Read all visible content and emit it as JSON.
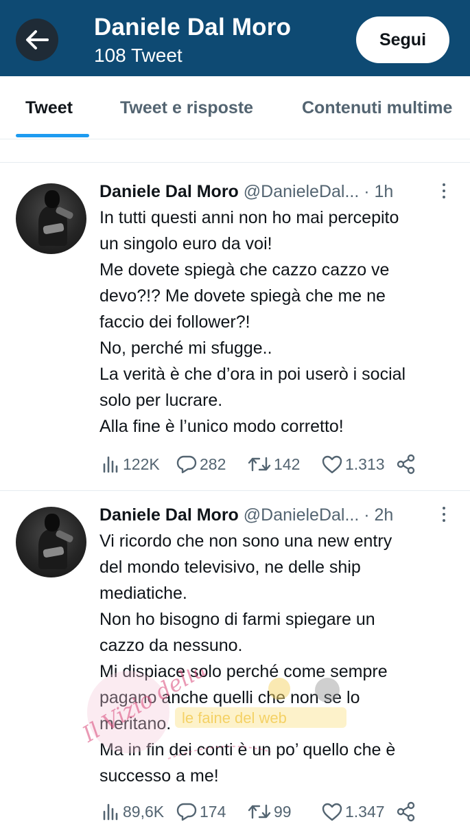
{
  "header": {
    "title": "Daniele Dal Moro",
    "subtitle": "108 Tweet",
    "follow_label": "Segui",
    "background": "#0e4a73"
  },
  "tabs": [
    {
      "label": "Tweet",
      "active": true
    },
    {
      "label": "Tweet e risposte",
      "active": false
    },
    {
      "label": "Contenuti multime",
      "active": false
    }
  ],
  "accent": "#1d9bf0",
  "tweets": [
    {
      "name": "Daniele Dal Moro",
      "handle": "@DanieleDal...",
      "time": "· 1h",
      "lines": [
        "In tutti questi anni non ho mai percepito",
        "un singolo euro da voi!",
        "Me dovete spiegà che cazzo cazzo ve",
        "devo?!? Me dovete spiegà che me ne",
        "faccio dei follower?!",
        "No, perché mi sfugge..",
        "La verità è che d’ora in poi userò i social",
        "solo per lucrare.",
        "Alla fine è l’unico modo corretto!"
      ],
      "views": "122K",
      "replies": "282",
      "retweets": "142",
      "likes": "1.313"
    },
    {
      "name": "Daniele Dal Moro",
      "handle": "@DanieleDal...",
      "time": "· 2h",
      "lines": [
        "Vi ricordo che non sono una new entry",
        "del mondo televisivo, ne delle ship",
        "mediatiche.",
        "Non ho bisogno di farmi spiegare un",
        "cazzo da nessuno.",
        "Mi dispiace solo perché come sempre",
        "pagano anche quelli che non se lo",
        "meritano.",
        "Ma in fin dei conti è un po’ quello che è",
        "successo a me!"
      ],
      "views": "89,6K",
      "replies": "174",
      "retweets": "99",
      "likes": "1.347"
    }
  ],
  "watermark": {
    "script": "Il Vizio della Vedo",
    "banner": "le faine del web"
  }
}
